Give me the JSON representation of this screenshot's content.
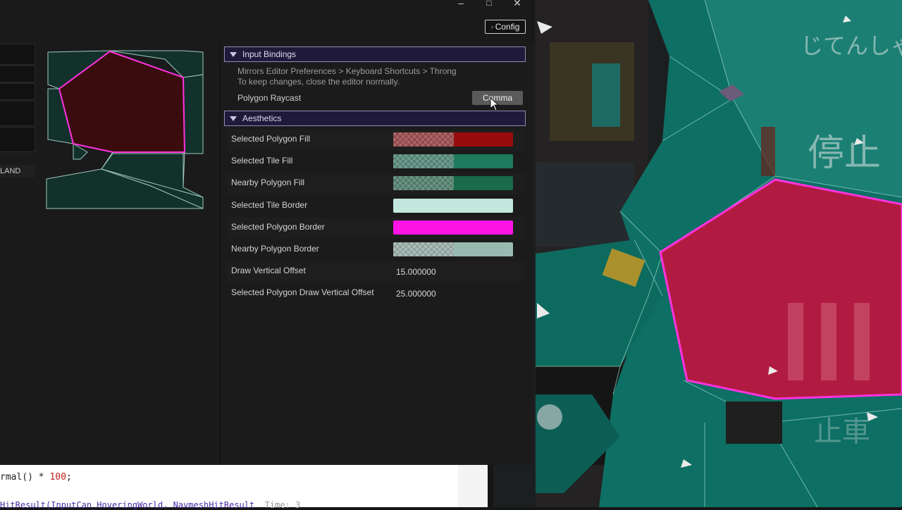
{
  "window_controls": {
    "minimize": "–",
    "maximize": "□",
    "close": "✕"
  },
  "toolbar": {
    "config_label": "Config"
  },
  "left_panel": {
    "land_label": "LAND"
  },
  "input_bindings": {
    "title": "Input Bindings",
    "hint_line1": "Mirrors Editor Preferences > Keyboard Shortcuts > Throng",
    "hint_line2": "To keep changes, close the editor normally.",
    "binding_label": "Polygon Raycast",
    "binding_key": "Comma"
  },
  "aesthetics": {
    "title": "Aesthetics",
    "rows": [
      {
        "label": "Selected Polygon Fill",
        "kind": "color",
        "color": "#980c0e",
        "alpha": 0.5
      },
      {
        "label": "Selected Tile Fill",
        "kind": "color",
        "color": "#1f7a5e",
        "alpha": 0.5
      },
      {
        "label": "Nearby Polygon Fill",
        "kind": "color",
        "color": "#1a6a4c",
        "alpha": 0.5
      },
      {
        "label": "Selected Tile Border",
        "kind": "color",
        "color": "#c2e8de",
        "alpha": 1
      },
      {
        "label": "Selected Polygon Border",
        "kind": "color",
        "color": "#ff14e6",
        "alpha": 1
      },
      {
        "label": "Nearby Polygon Border",
        "kind": "color",
        "color": "#98bab1",
        "alpha": 0.5
      },
      {
        "label": "Draw Vertical Offset",
        "kind": "number",
        "value": "15.000000"
      },
      {
        "label": "Selected Polygon Draw Vertical Offset",
        "kind": "number",
        "value": "25.000000"
      }
    ]
  },
  "code": {
    "line1_prefix": "rmal() * ",
    "line1_number": "100",
    "line1_suffix": ";",
    "line2": "HitResult(InputCan_HoveringWorld, NavmeshHitResult",
    "line2_hint": "Time: 3"
  },
  "scene": {
    "sign_text_1": "じてんしゃ",
    "sign_text_2": "停止",
    "sign_text_3": "止車"
  },
  "colors": {
    "selection_fill": "#c8103c",
    "selection_border": "#ff32e0",
    "navmesh_fill": "#0e7d6e"
  }
}
